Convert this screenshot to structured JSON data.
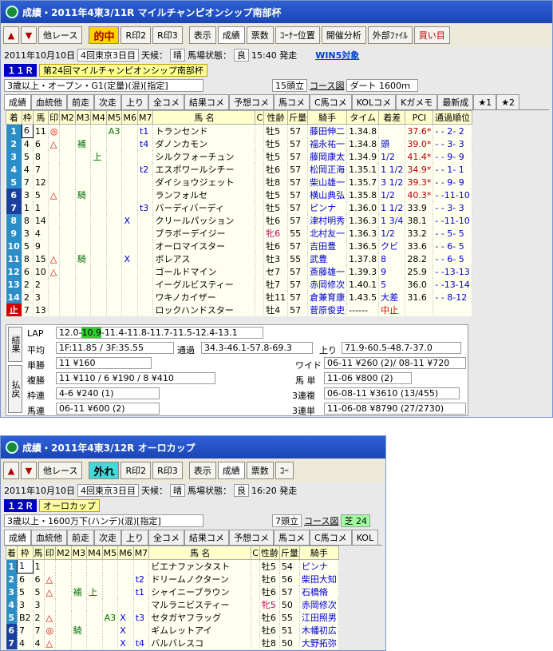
{
  "race1": {
    "title": "成績・2011年4東3/11R マイルチャンピオンシップ南部杯",
    "toolbar": {
      "prev_race": "他レース",
      "result": "的中",
      "r_print2": "R印2",
      "r_print3": "R印3",
      "view": "表示",
      "seiseki": "成績",
      "payout": "票数",
      "corner": "ｺｰﾅｰ位置",
      "analysis": "開催分析",
      "external": "外部ﾌｧｲﾙ",
      "buy": "買い目"
    },
    "date": "2011年10月10日",
    "meeting": "4回東京3日目",
    "weather_label": "天候：",
    "weather": "晴",
    "track_label": "馬場状態：",
    "track": "良",
    "post_time": "15:40 発走",
    "win5": "WIN5対象",
    "race_no": "１１Ｒ",
    "race_name": "第24回マイルチャンピオンシップ南部杯",
    "conditions": "3歳以上・オープン・G1(定量)(混)[指定]",
    "runners": "15頭立",
    "course_link": "コース図",
    "course": "ダート 1600ｍ",
    "tabs": [
      "成績",
      "血統他",
      "前走",
      "次走",
      "上り",
      "全コメ",
      "結果コメ",
      "予想コメ",
      "馬コメ",
      "C馬コメ",
      "KOLコメ",
      "Kガメモ",
      "最新成",
      "★1",
      "★2"
    ],
    "headers": [
      "着",
      "枠",
      "馬",
      "印",
      "M2",
      "M3",
      "M4",
      "M5",
      "M6",
      "M7",
      "馬 名",
      "C",
      "性齢",
      "斤量",
      "騎手",
      "タイム",
      "着差",
      "PCI",
      "通過順位"
    ],
    "rows": [
      {
        "rk": "1",
        "w": "6",
        "u": "11",
        "m": "◎",
        "m2": "",
        "m3": "",
        "m4": "",
        "m5": "A3",
        "m6": "",
        "m7": "t1",
        "name": "トランセンド",
        "c": "",
        "sa": "牡5",
        "kin": "57",
        "jockey": "藤田伸二",
        "time": "1.34.8",
        "diff": "",
        "pci": "37.6*",
        "pass": "-  -  2-  2"
      },
      {
        "rk": "2",
        "w": "4",
        "u": "6",
        "m": "△",
        "m2": "",
        "m3": "補",
        "m4": "",
        "m5": "",
        "m6": "",
        "m7": "t4",
        "name": "ダノンカモン",
        "c": "",
        "sa": "牡5",
        "kin": "57",
        "jockey": "福永祐一",
        "time": "1.34.8",
        "diff": "頭",
        "pci": "39.0*",
        "pass": "-  -  3-  3"
      },
      {
        "rk": "3",
        "w": "5",
        "u": "8",
        "m": "",
        "m2": "",
        "m3": "",
        "m4": "上",
        "m5": "",
        "m6": "",
        "m7": "",
        "name": "シルクフォーチュン",
        "c": "",
        "sa": "牡5",
        "kin": "57",
        "jockey": "藤岡康太",
        "time": "1.34.9",
        "diff": "1/2",
        "pci": "41.4*",
        "pass": "-  -  9-  9"
      },
      {
        "rk": "4",
        "w": "4",
        "u": "7",
        "m": "",
        "m2": "",
        "m3": "",
        "m4": "",
        "m5": "",
        "m6": "",
        "m7": "t2",
        "name": "エスポワールシチー",
        "c": "",
        "sa": "牡6",
        "kin": "57",
        "jockey": "松岡正海",
        "time": "1.35.1",
        "diff": "1 1/2",
        "pci": "34.9*",
        "pass": "-  -  1-  1"
      },
      {
        "rk": "5",
        "w": "7",
        "u": "12",
        "m": "",
        "m2": "",
        "m3": "",
        "m4": "",
        "m5": "",
        "m6": "",
        "m7": "",
        "name": "ダイショウジェット",
        "c": "",
        "sa": "牡8",
        "kin": "57",
        "jockey": "柴山雄一",
        "time": "1.35.7",
        "diff": "3 1/2",
        "pci": "39.3*",
        "pass": "-  -  9-  9"
      },
      {
        "rk": "6",
        "w": "3",
        "u": "5",
        "m": "△",
        "m2": "",
        "m3": "騎",
        "m4": "",
        "m5": "",
        "m6": "",
        "m7": "",
        "name": "ランフォルセ",
        "c": "",
        "sa": "牡5",
        "kin": "57",
        "jockey": "横山典弘",
        "time": "1.35.8",
        "diff": "1/2",
        "pci": "40.3*",
        "pass": "-  -11-10"
      },
      {
        "rk": "7",
        "w": "1",
        "u": "1",
        "m": "",
        "m2": "",
        "m3": "",
        "m4": "",
        "m5": "",
        "m6": "",
        "m7": "t3",
        "name": "バーディバーディ",
        "c": "",
        "sa": "牡5",
        "kin": "57",
        "jockey": "ピンナ",
        "time": "1.36.0",
        "diff": "1 1/2",
        "pci": "33.9",
        "pass": "-  -  3-  3"
      },
      {
        "rk": "8",
        "w": "8",
        "u": "14",
        "m": "",
        "m2": "",
        "m3": "",
        "m4": "",
        "m5": "",
        "m6": "X",
        "m7": "",
        "name": "クリールパッション",
        "c": "",
        "sa": "牡6",
        "kin": "57",
        "jockey": "津村明秀",
        "time": "1.36.3",
        "diff": "1 3/4",
        "pci": "38.1",
        "pass": "-  -11-10"
      },
      {
        "rk": "9",
        "w": "3",
        "u": "4",
        "m": "",
        "m2": "",
        "m3": "",
        "m4": "",
        "m5": "",
        "m6": "",
        "m7": "",
        "name": "ブラボーデイジー",
        "c": "",
        "sa": "牝6",
        "kin": "55",
        "jockey": "北村友一",
        "time": "1.36.3",
        "diff": "1/2",
        "pci": "33.2",
        "pass": "-  -  5-  5"
      },
      {
        "rk": "10",
        "w": "5",
        "u": "9",
        "m": "",
        "m2": "",
        "m3": "",
        "m4": "",
        "m5": "",
        "m6": "",
        "m7": "",
        "name": "オーロマイスター",
        "c": "",
        "sa": "牡6",
        "kin": "57",
        "jockey": "吉田豊",
        "time": "1.36.5",
        "diff": "クビ",
        "pci": "33.6",
        "pass": "-  -  6-  5"
      },
      {
        "rk": "11",
        "w": "8",
        "u": "15",
        "m": "△",
        "m2": "",
        "m3": "騎",
        "m4": "",
        "m5": "",
        "m6": "X",
        "m7": "",
        "name": "ボレアス",
        "c": "",
        "sa": "牡3",
        "kin": "55",
        "jockey": "武豊",
        "time": "1.37.8",
        "diff": "8",
        "pci": "28.2",
        "pass": "-  -  6-  5"
      },
      {
        "rk": "12",
        "w": "6",
        "u": "10",
        "m": "△",
        "m2": "",
        "m3": "",
        "m4": "",
        "m5": "",
        "m6": "",
        "m7": "",
        "name": "ゴールドマイン",
        "c": "",
        "sa": "セ7",
        "kin": "57",
        "jockey": "斎藤雄一",
        "time": "1.39.3",
        "diff": "9",
        "pci": "25.9",
        "pass": "-  -13-13"
      },
      {
        "rk": "13",
        "w": "2",
        "u": "2",
        "m": "",
        "m2": "",
        "m3": "",
        "m4": "",
        "m5": "",
        "m6": "",
        "m7": "",
        "name": "イーグルビスティー",
        "c": "",
        "sa": "牡7",
        "kin": "57",
        "jockey": "赤岡修次",
        "time": "1.40.1",
        "diff": "5",
        "pci": "36.0",
        "pass": "-  -13-14"
      },
      {
        "rk": "14",
        "w": "2",
        "u": "3",
        "m": "",
        "m2": "",
        "m3": "",
        "m4": "",
        "m5": "",
        "m6": "",
        "m7": "",
        "name": "ワキノカイザー",
        "c": "",
        "sa": "牡11",
        "kin": "57",
        "jockey": "倉兼育康",
        "time": "1.43.5",
        "diff": "大差",
        "pci": "31.6",
        "pass": "-  -  8-12"
      },
      {
        "rk": "止",
        "w": "7",
        "u": "13",
        "m": "",
        "m2": "",
        "m3": "",
        "m4": "",
        "m5": "",
        "m6": "",
        "m7": "",
        "name": "ロックハンドスター",
        "c": "",
        "sa": "牡4",
        "kin": "57",
        "jockey": "菅原俊吏",
        "time": "------",
        "diff": "中止",
        "pci": "",
        "pass": ""
      }
    ],
    "payout": {
      "vlabel1": "結果",
      "vlabel2": "払戻",
      "lap_label": "LAP",
      "lap_pre": "12.0-",
      "lap_hl": "10.9",
      "lap_post": "-11.4-11.8-11.7-11.5-12.4-13.1",
      "avg_label": "平均",
      "avg": "1F:11.85 / 3F:35.55",
      "tsuka_label": "通過",
      "tsuka": "34.3-46.1-57.8-69.3",
      "agari_label": "上り",
      "agari": "71.9-60.5-48.7-37.0",
      "tansho_label": "単勝",
      "tansho": "11 ¥160",
      "fukusho_label": "複勝",
      "fukusho": "11 ¥110 / 6 ¥190 / 8 ¥410",
      "wakuren_label": "枠連",
      "wakuren": "4-6 ¥240 (1)",
      "umaren_label": "馬連",
      "umaren": "06-11 ¥600 (2)",
      "wide_label": "ワイド",
      "wide": "06-11 ¥260 (2)/ 08-11 ¥720",
      "umatan_label": "馬 単",
      "umatan": "11-06 ¥800 (2)",
      "sanrenpuku_label": "3連複",
      "sanrenpuku": "06-08-11 ¥3610 (13/455)",
      "sanrentan_label": "3連単",
      "sanrentan": "11-06-08 ¥8790 (27/2730)"
    }
  },
  "race2": {
    "title": "成績・2011年4東3/12R オーロカップ",
    "toolbar": {
      "prev_race": "他レース",
      "result": "外れ",
      "r_print2": "R印2",
      "r_print3": "R印3",
      "view": "表示",
      "seiseki": "成績",
      "payout": "票数",
      "corner": "ｺｰ"
    },
    "date": "2011年10月10日",
    "meeting": "4回東京3日目",
    "weather_label": "天候：",
    "weather": "晴",
    "track_label": "馬場状態：",
    "track": "良",
    "post_time": "16:20 発走",
    "race_no": "１２Ｒ",
    "race_name": "オーロカップ",
    "conditions": "3歳以上・1600万下(ハンデ)(混)[指定]",
    "runners": "7頭立",
    "course_link": "コース図",
    "course": "芝 24",
    "tabs": [
      "成績",
      "血統他",
      "前走",
      "次走",
      "上り",
      "全コメ",
      "結果コメ",
      "予想コメ",
      "馬コメ",
      "C馬コメ",
      "KOL"
    ],
    "headers": [
      "着",
      "枠",
      "馬",
      "印",
      "M2",
      "M3",
      "M4",
      "M5",
      "M6",
      "M7",
      "馬 名",
      "C",
      "性齢",
      "斤量",
      "騎手"
    ],
    "rows": [
      {
        "rk": "1",
        "w": "1",
        "u": "1",
        "m": "",
        "m3": "",
        "m4": "",
        "m5": "",
        "m6": "",
        "m7": "",
        "name": "ビエナファンタスト",
        "sa": "牡5",
        "kin": "54",
        "jockey": "ピンナ"
      },
      {
        "rk": "2",
        "w": "6",
        "u": "6",
        "m": "△",
        "m3": "",
        "m4": "",
        "m5": "",
        "m6": "",
        "m7": "t2",
        "name": "ドリームノクターン",
        "sa": "牡6",
        "kin": "56",
        "jockey": "柴田大知"
      },
      {
        "rk": "3",
        "w": "5",
        "u": "5",
        "m": "△",
        "m3": "補",
        "m4": "上",
        "m5": "",
        "m6": "",
        "m7": "t1",
        "name": "シャイニーブラウン",
        "sa": "牡6",
        "kin": "57",
        "jockey": "石橋脩"
      },
      {
        "rk": "4",
        "w": "3",
        "u": "3",
        "m": "",
        "m3": "",
        "m4": "",
        "m5": "",
        "m6": "",
        "m7": "",
        "name": "マルラニビスティー",
        "sa": "牝5",
        "kin": "50",
        "jockey": "赤岡修次"
      },
      {
        "rk": "5",
        "w": "B2",
        "u": "2",
        "m": "△",
        "m3": "",
        "m4": "",
        "m5": "A3",
        "m6": "X",
        "m7": "t3",
        "name": "セタガヤフラッグ",
        "sa": "牡6",
        "kin": "55",
        "jockey": "江田照男"
      },
      {
        "rk": "6",
        "w": "7",
        "u": "7",
        "m": "◎",
        "m3": "騎",
        "m4": "",
        "m5": "",
        "m6": "X",
        "m7": "",
        "name": "ギムレットアイ",
        "sa": "牡6",
        "kin": "51",
        "jockey": "木幡初広"
      },
      {
        "rk": "7",
        "w": "4",
        "u": "4",
        "m": "△",
        "m3": "",
        "m4": "",
        "m5": "",
        "m6": "X",
        "m7": "t4",
        "name": "バルバレスコ",
        "sa": "牡8",
        "kin": "50",
        "jockey": "大野拓弥"
      }
    ]
  },
  "colors": {
    "rank_bg": [
      "#2c8ec8",
      "#2c8ec8",
      "#2c8ec8",
      "#2c8ec8",
      "#2c8ec8",
      "#1a3fa0",
      "#1a3fa0",
      "#2c8ec8",
      "#2c8ec8",
      "#2c8ec8",
      "#2c8ec8",
      "#2c8ec8",
      "#2c8ec8",
      "#2c8ec8",
      "#d00000"
    ]
  }
}
